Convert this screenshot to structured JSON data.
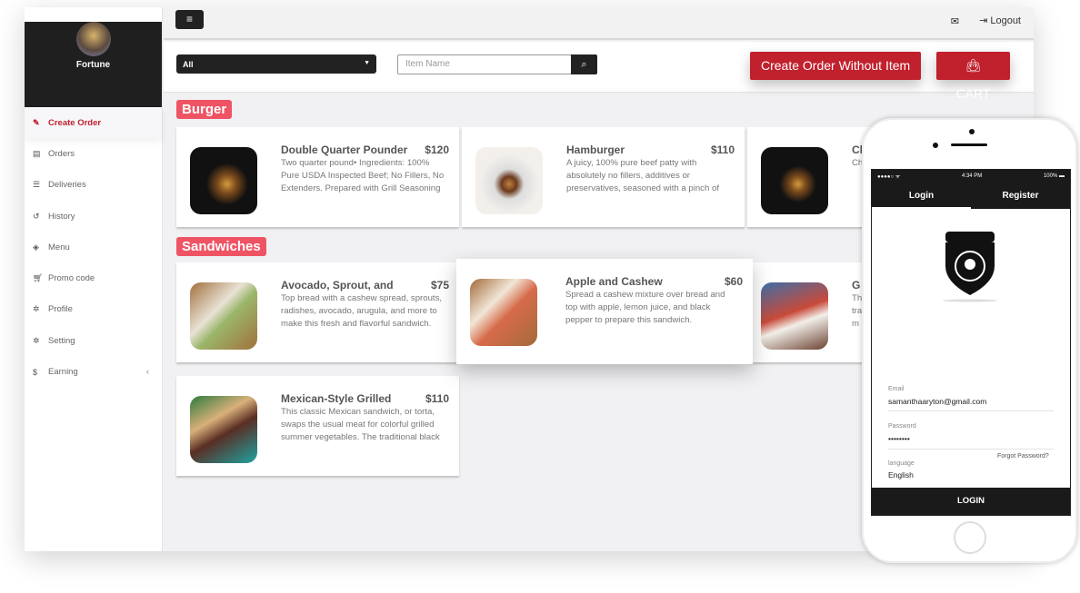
{
  "sidebar": {
    "name": "Fortune",
    "items": [
      {
        "label": "Create Order",
        "icon": "edit-icon"
      },
      {
        "label": "Orders",
        "icon": "card-icon"
      },
      {
        "label": "Deliveries",
        "icon": "list-icon"
      },
      {
        "label": "History",
        "icon": "history-icon"
      },
      {
        "label": "Menu",
        "icon": "cube-icon"
      },
      {
        "label": "Promo code",
        "icon": "cart-icon"
      },
      {
        "label": "Profile",
        "icon": "gear-icon"
      },
      {
        "label": "Setting",
        "icon": "gear-icon"
      },
      {
        "label": "Earning",
        "icon": "dollar-icon"
      }
    ]
  },
  "topbar": {
    "logout": "Logout"
  },
  "filter": {
    "category": "All",
    "search_placeholder": "Item Name",
    "create_order": "Create Order Without Item",
    "cart": "CART"
  },
  "colors": {
    "accent": "#c1202d",
    "category_badge": "#ef5464",
    "dark": "#1f1f1f"
  },
  "categories": [
    {
      "name": "Burger",
      "items": [
        {
          "title": "Double Quarter Pounder",
          "price": "$120",
          "desc": "Two quarter pound• Ingredients: 100% Pure USDA Inspected Beef; No Fillers, No Extenders. Prepared with Grill Seasoning"
        },
        {
          "title": "Hamburger",
          "price": "$110",
          "desc": "A juicy, 100% pure beef patty with absolutely no fillers, additives or preservatives, seasoned with a pinch of"
        },
        {
          "title": "Ch",
          "price": "",
          "desc": "Ch"
        }
      ]
    },
    {
      "name": "Sandwiches",
      "items": [
        {
          "title": "Avocado, Sprout, and",
          "price": "$75",
          "desc": "Top bread with a cashew spread, sprouts, radishes, avocado, arugula, and more to make this fresh and flavorful sandwich."
        },
        {
          "title": "Apple and Cashew",
          "price": "$60",
          "desc": "Spread a cashew mixture over bread and top with apple, lemon juice, and black pepper to prepare this sandwich."
        },
        {
          "title": "G",
          "price": "",
          "desc": "Th tra m"
        },
        {
          "title": "Mexican-Style Grilled",
          "price": "$110",
          "desc": "This classic Mexican sandwich, or torta, swaps the usual meat for colorful grilled summer vegetables. The traditional black"
        }
      ]
    }
  ],
  "phone": {
    "time": "4:34 PM",
    "battery": "100%",
    "tabs": [
      "Login",
      "Register"
    ],
    "email_label": "Email",
    "email": "samanthaaryton@gmail.com",
    "password_label": "Password",
    "password": "••••••••",
    "forgot": "Forgot Password?",
    "language_label": "language",
    "language": "English",
    "login": "LOGIN"
  }
}
